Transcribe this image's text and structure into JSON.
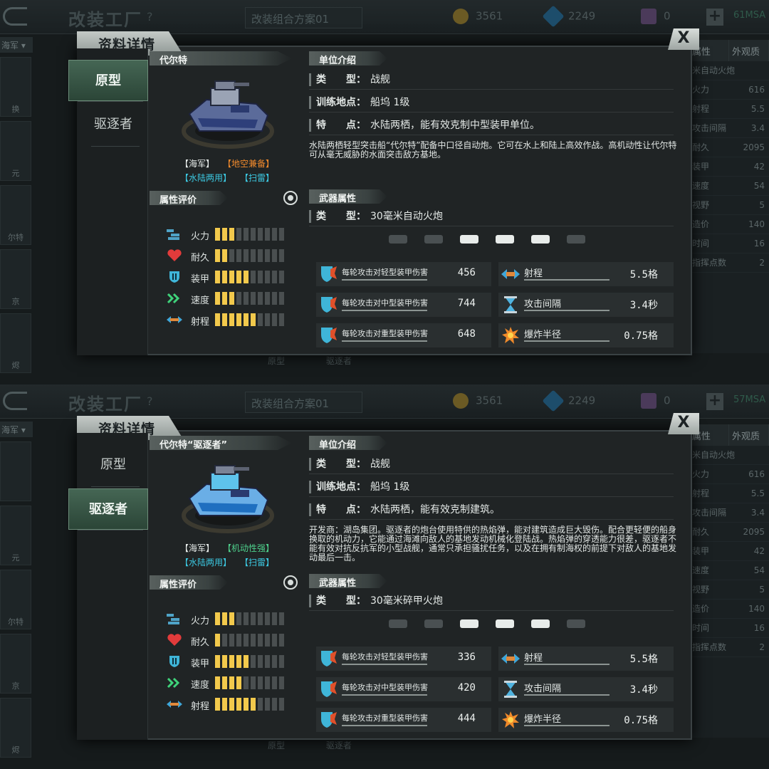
{
  "background": {
    "title": "改装工厂",
    "help": "?",
    "scheme": "改装组合方案01",
    "gold": "3561",
    "gems": "2249",
    "cards": "0",
    "id_text_top": "61MSA",
    "id_text_bottom": "57MSA",
    "filter": "海军",
    "left_thumbs": [
      "换",
      "元",
      "尔特",
      "京",
      "烬"
    ],
    "left_thumbs_bottom": [
      "",
      "元",
      "尔特",
      "京",
      "烬"
    ],
    "zoom_label": "资料详情",
    "right_tabs": [
      "属性",
      "外观质"
    ],
    "right_rows": [
      {
        "label": "米自动火炮",
        "value": ""
      },
      {
        "label": "火力",
        "value": "616"
      },
      {
        "label": "射程",
        "value": "5.5"
      },
      {
        "label": "攻击间隔",
        "value": "3.4"
      },
      {
        "label": "耐久",
        "value": "2095"
      },
      {
        "label": "装甲",
        "value": "42"
      },
      {
        "label": "速度",
        "value": "54"
      },
      {
        "label": "视野",
        "value": "5"
      },
      {
        "label": "造价",
        "value": "140"
      },
      {
        "label": "时间",
        "value": "16"
      },
      {
        "label": "指挥点数",
        "value": "2"
      }
    ],
    "bottom_labels": [
      "原型",
      "驱逐者"
    ]
  },
  "dialog_title": "资料详情",
  "close_label": "X",
  "panels": [
    {
      "tabs": [
        "原型",
        "驱逐者"
      ],
      "active_tab": 0,
      "unit_name": "代尔特",
      "tags": [
        {
          "text": "【海军】",
          "color": "white"
        },
        {
          "text": "【地空兼备】",
          "color": "orange"
        },
        {
          "text": "【水陆两用】",
          "color": "cyan"
        },
        {
          "text": "【扫雷】",
          "color": "cyan"
        }
      ],
      "attr_header": "属性评价",
      "attributes": [
        {
          "label": "火力",
          "icon": "firepower-icon",
          "value": 3,
          "max": 10
        },
        {
          "label": "耐久",
          "icon": "heart-icon",
          "value": 2,
          "max": 10
        },
        {
          "label": "装甲",
          "icon": "shield-icon",
          "value": 5,
          "max": 10
        },
        {
          "label": "速度",
          "icon": "chevron-speed-icon",
          "value": 3,
          "max": 10
        },
        {
          "label": "射程",
          "icon": "range-arrow-icon",
          "value": 6,
          "max": 10
        }
      ],
      "intro_header": "单位介绍",
      "intro_rows": [
        {
          "label": "类　　型：",
          "value": "战舰"
        },
        {
          "label": "训练地点：",
          "value": "船坞 1级"
        },
        {
          "label": "特　　点：",
          "value": "水陆两栖，能有效克制中型装甲单位。"
        }
      ],
      "description": "水陆两栖轻型突击船“代尔特”配备中口径自动炮。它可在水上和陆上高效作战。高机动性让代尔特可从毫无威胁的水面突击敌方基地。",
      "weapon_header": "武器属性",
      "weapon_type_label": "类　　型：",
      "weapon_type": "30毫米自动火炮",
      "targets": [
        {
          "icon": "jet-icon",
          "active": false
        },
        {
          "icon": "plane-icon",
          "active": false
        },
        {
          "icon": "helicopter-icon",
          "active": true
        },
        {
          "icon": "tank-icon",
          "active": true
        },
        {
          "icon": "ship-icon",
          "active": true
        },
        {
          "icon": "submarine-icon",
          "active": false
        }
      ],
      "stats": [
        {
          "name": "每轮攻击对轻型装甲伤害",
          "value": "456"
        },
        {
          "name": "射程",
          "value": "5.5格"
        },
        {
          "name": "每轮攻击对中型装甲伤害",
          "value": "744"
        },
        {
          "name": "攻击间隔",
          "value": "3.4秒"
        },
        {
          "name": "每轮攻击对重型装甲伤害",
          "value": "648"
        },
        {
          "name": "爆炸半径",
          "value": "0.75格"
        }
      ]
    },
    {
      "tabs": [
        "原型",
        "驱逐者"
      ],
      "active_tab": 1,
      "unit_name": "代尔特“驱逐者”",
      "tags": [
        {
          "text": "【海军】",
          "color": "white"
        },
        {
          "text": "【机动性强】",
          "color": "green"
        },
        {
          "text": "【水陆两用】",
          "color": "cyan"
        },
        {
          "text": "【扫雷】",
          "color": "cyan"
        }
      ],
      "attr_header": "属性评价",
      "attributes": [
        {
          "label": "火力",
          "icon": "firepower-icon",
          "value": 3,
          "max": 10
        },
        {
          "label": "耐久",
          "icon": "heart-icon",
          "value": 1,
          "max": 10
        },
        {
          "label": "装甲",
          "icon": "shield-icon",
          "value": 5,
          "max": 10
        },
        {
          "label": "速度",
          "icon": "chevron-speed-icon",
          "value": 4,
          "max": 10
        },
        {
          "label": "射程",
          "icon": "range-arrow-icon",
          "value": 6,
          "max": 10
        }
      ],
      "intro_header": "单位介绍",
      "intro_rows": [
        {
          "label": "类　　型：",
          "value": "战舰"
        },
        {
          "label": "训练地点：",
          "value": "船坞 1级"
        },
        {
          "label": "特　　点：",
          "value": "水陆两栖，能有效克制建筑。"
        }
      ],
      "description": "开发商：湖岛集团。驱逐者的炮台使用特供的热焰弹，能对建筑造成巨大毁伤。配合更轻便的船身换取的机动力，它能通过海滩向敌人的基地发动机械化登陆战。热焰弹的穿透能力很差，驱逐者不能有效对抗反抗军的小型战舰，通常只承担骚扰任务，以及在拥有制海权的前提下对敌人的基地发动最后一击。",
      "weapon_header": "武器属性",
      "weapon_type_label": "类　　型：",
      "weapon_type": "30毫米碎甲火炮",
      "targets": [
        {
          "icon": "jet-icon",
          "active": false
        },
        {
          "icon": "plane-icon",
          "active": false
        },
        {
          "icon": "helicopter-icon",
          "active": true
        },
        {
          "icon": "tank-icon",
          "active": true
        },
        {
          "icon": "ship-icon",
          "active": true
        },
        {
          "icon": "submarine-icon",
          "active": false
        }
      ],
      "stats": [
        {
          "name": "每轮攻击对轻型装甲伤害",
          "value": "336"
        },
        {
          "name": "射程",
          "value": "5.5格"
        },
        {
          "name": "每轮攻击对中型装甲伤害",
          "value": "420"
        },
        {
          "name": "攻击间隔",
          "value": "3.4秒"
        },
        {
          "name": "每轮攻击对重型装甲伤害",
          "value": "444"
        },
        {
          "name": "爆炸半径",
          "value": "0.75格"
        }
      ]
    }
  ],
  "colors": {
    "accent_green": "#456654",
    "bar_on": "#f2c94c",
    "tag_orange": "#f0892c",
    "tag_cyan": "#3cc9e2",
    "tag_green": "#4ed18c"
  }
}
